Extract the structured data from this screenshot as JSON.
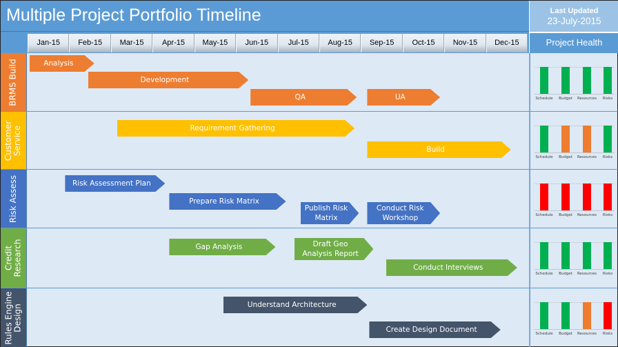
{
  "header": {
    "title": "Multiple Project Portfolio Timeline",
    "last_updated_label": "Last Updated",
    "last_updated_date": "23-July-2015",
    "health_title": "Project Health"
  },
  "months": [
    "Jan-15",
    "Feb-15",
    "Mar-15",
    "Apr-15",
    "May-15",
    "Jun-15",
    "Jul-15",
    "Aug-15",
    "Sep-15",
    "Oct-15",
    "Nov-15",
    "Dec-15"
  ],
  "health_categories": [
    "Schedule",
    "Budget",
    "Resources",
    "Risks"
  ],
  "status_colors": {
    "green": "#00b050",
    "amber": "#ed7d31",
    "red": "#ff0000"
  },
  "lanes": [
    {
      "name": "BRMS Build",
      "color": "#ed7d31",
      "health": [
        "green",
        "green",
        "green",
        "green"
      ],
      "tasks": [
        {
          "label": "Analysis",
          "start_month": 0.05,
          "end_month": 1.6,
          "row": 0
        },
        {
          "label": "Development",
          "start_month": 1.45,
          "end_month": 5.3,
          "row": 1
        },
        {
          "label": "QA",
          "start_month": 5.35,
          "end_month": 7.9,
          "row": 2
        },
        {
          "label": "UA",
          "start_month": 8.15,
          "end_month": 9.9,
          "row": 2
        }
      ]
    },
    {
      "name": "Customer\nService",
      "color": "#ffc000",
      "health": [
        "green",
        "amber",
        "amber",
        "green"
      ],
      "tasks": [
        {
          "label": "Requirement Gathering",
          "start_month": 2.15,
          "end_month": 7.85,
          "row": 0
        },
        {
          "label": "Build",
          "start_month": 8.15,
          "end_month": 11.6,
          "row": 1
        }
      ]
    },
    {
      "name": "Risk Assess",
      "color": "#4472c4",
      "health": [
        "red",
        "red",
        "red",
        "red"
      ],
      "tasks": [
        {
          "label": "Risk Assessment Plan",
          "start_month": 0.9,
          "end_month": 3.3,
          "row": 0
        },
        {
          "label": "Prepare Risk Matrix",
          "start_month": 3.4,
          "end_month": 6.2,
          "row": 1
        },
        {
          "label": "Publish Risk\nMatrix",
          "start_month": 6.55,
          "end_month": 7.95,
          "row": 2
        },
        {
          "label": "Conduct Risk\nWorkshop",
          "start_month": 8.15,
          "end_month": 9.9,
          "row": 2
        }
      ]
    },
    {
      "name": "Credit\nResearch",
      "color": "#70ad47",
      "health": [
        "green",
        "green",
        "green",
        "green"
      ],
      "tasks": [
        {
          "label": "Gap Analysis",
          "start_month": 3.4,
          "end_month": 5.95,
          "row": 0
        },
        {
          "label": "Draft Geo\nAnalysis Report",
          "start_month": 6.4,
          "end_month": 8.3,
          "row": 0
        },
        {
          "label": "Conduct Interviews",
          "start_month": 8.6,
          "end_month": 11.75,
          "row": 1
        }
      ]
    },
    {
      "name": "Rules Engine\nDesign",
      "color": "#44546a",
      "health": [
        "green",
        "green",
        "amber",
        "red"
      ],
      "tasks": [
        {
          "label": "Understand Architecture",
          "start_month": 4.7,
          "end_month": 8.15,
          "row": 0
        },
        {
          "label": "Create Design Document",
          "start_month": 8.2,
          "end_month": 11.35,
          "row": 1
        }
      ]
    }
  ]
}
